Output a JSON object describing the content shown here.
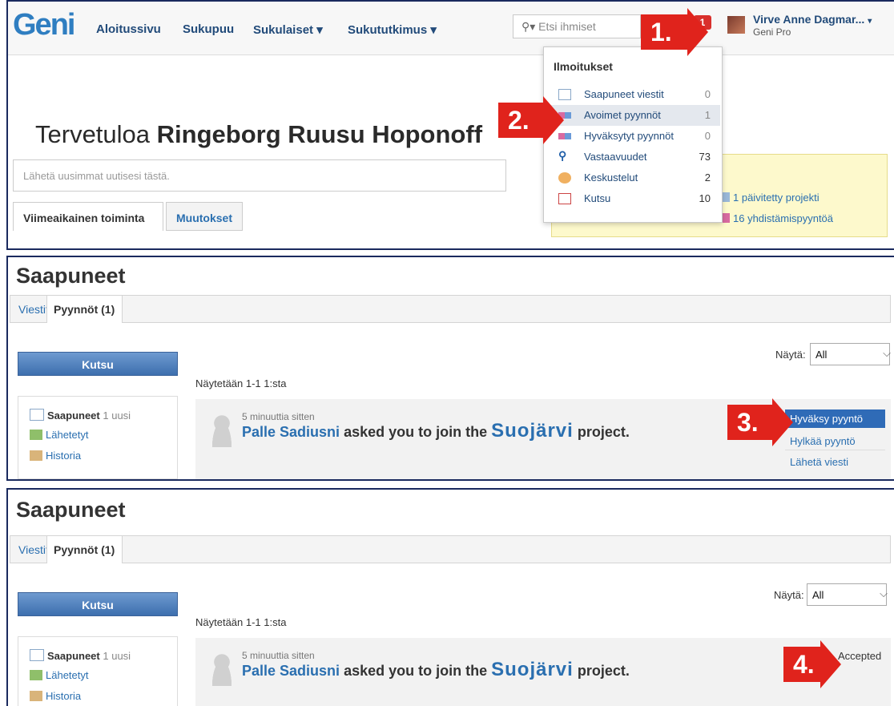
{
  "header": {
    "logo": "Geni",
    "nav": [
      "Aloitussivu",
      "Sukupuu",
      "Sukulaiset ▾",
      "Sukututkimus ▾"
    ],
    "search_placeholder": "Etsi ihmiset",
    "notif_count": "1",
    "user_name": "Virve Anne Dagmar...",
    "user_role": "Geni Pro"
  },
  "welcome": {
    "prefix": "Tervetuloa",
    "name": "Ringeborg Ruusu Hoponoff"
  },
  "news_placeholder": "Lähetä uusimmat uutisesi tästä.",
  "home_tabs": [
    "Viimeaikainen toiminta",
    "Muutokset"
  ],
  "notifications": {
    "title": "Ilmoitukset",
    "items": [
      {
        "label": "Saapuneet viestit",
        "count": "0",
        "icon": "envelope-icon"
      },
      {
        "label": "Avoimet pyynnöt",
        "count": "1",
        "icon": "request-icon"
      },
      {
        "label": "Hyväksytyt pyynnöt",
        "count": "0",
        "icon": "accepted-request-icon"
      },
      {
        "label": "Vastaavuudet",
        "count": "73",
        "icon": "magnifier-icon"
      },
      {
        "label": "Keskustelut",
        "count": "2",
        "icon": "discussion-icon"
      },
      {
        "label": "Kutsu",
        "count": "10",
        "icon": "invite-icon"
      }
    ]
  },
  "yellow_links": [
    "1 päivitetty projekti",
    "16 yhdistämispyyntöä"
  ],
  "steps": [
    "1.",
    "2.",
    "3.",
    "4."
  ],
  "inbox": {
    "title": "Saapuneet",
    "tabs": [
      "Viestit",
      "Pyynnöt (1)"
    ],
    "invite_button": "Kutsu",
    "folders": [
      {
        "label": "Saapuneet",
        "extra": "1 uusi"
      },
      {
        "label": "Lähetetyt",
        "extra": ""
      },
      {
        "label": "Historia",
        "extra": ""
      }
    ],
    "show_label": "Näytä:",
    "show_value": "All",
    "showing": "Näytetään 1-1 1:sta",
    "request": {
      "time": "5 minuuttia sitten",
      "name": "Palle Sadiusni",
      "mid": "asked you to join the",
      "project": "Suojärvi",
      "end": "project."
    },
    "actions": [
      "Hyväksy pyyntö",
      "Hylkää pyyntö",
      "Lähetä viesti"
    ],
    "status": "Accepted"
  }
}
